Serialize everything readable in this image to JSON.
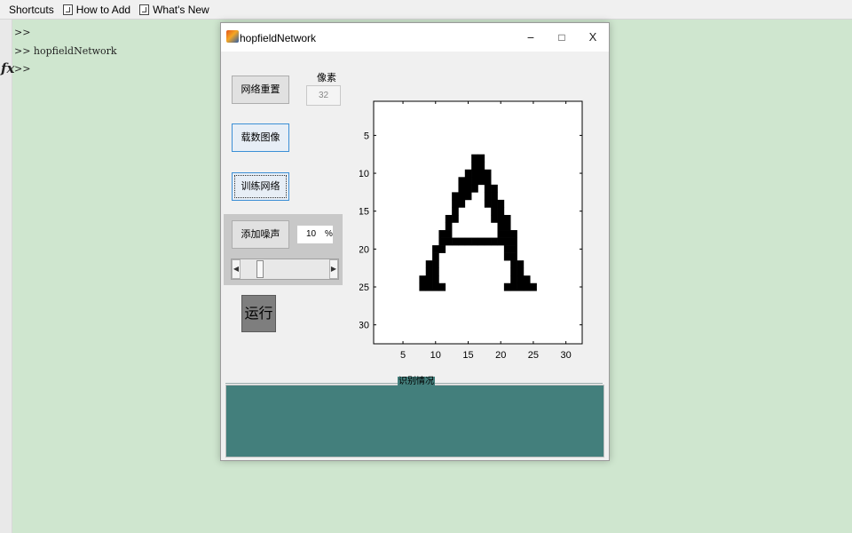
{
  "toolbar": {
    "shortcuts": "Shortcuts",
    "how_to_add": "How to Add",
    "whats_new": "What's New"
  },
  "command_window": {
    "lines": [
      ">>",
      ">> hopfieldNetwork",
      ">>"
    ],
    "fx": "fx"
  },
  "figure": {
    "title": "hopfieldNetwork",
    "controls": {
      "minimize": "−",
      "maximize": "□",
      "close": "X"
    },
    "reset_button": "网络重置",
    "pixel_label": "像素",
    "pixel_value": "32",
    "load_button": "载数图像",
    "train_button": "训练网络",
    "noise_button": "添加噪声",
    "noise_value": "10",
    "noise_unit": "%",
    "slider_level": 0.2,
    "run_button": "运行",
    "status_title": "识别情况"
  },
  "chart_data": {
    "type": "heatmap",
    "title": "",
    "xlabel": "",
    "ylabel": "",
    "xlim": [
      0.5,
      32.5
    ],
    "ylim": [
      0.5,
      32.5
    ],
    "y_reversed": true,
    "xticks": [
      5,
      10,
      15,
      20,
      25,
      30
    ],
    "yticks": [
      5,
      10,
      15,
      20,
      25,
      30
    ],
    "colors": {
      "on": "#000000",
      "off": "#ffffff"
    },
    "black_pixels_by_row": {
      "8": [
        16,
        17
      ],
      "9": [
        16,
        17
      ],
      "10": [
        15,
        16,
        17,
        18
      ],
      "11": [
        14,
        15,
        16,
        17,
        18
      ],
      "12": [
        14,
        15,
        16,
        18,
        19
      ],
      "13": [
        13,
        14,
        15,
        18,
        19
      ],
      "14": [
        13,
        14,
        18,
        19,
        20
      ],
      "15": [
        13,
        19,
        20
      ],
      "16": [
        12,
        13,
        19,
        20,
        21
      ],
      "17": [
        12,
        20,
        21
      ],
      "18": [
        11,
        12,
        20,
        21,
        22
      ],
      "19": [
        11,
        12,
        13,
        14,
        15,
        16,
        17,
        18,
        19,
        20,
        21,
        22
      ],
      "20": [
        10,
        11,
        21,
        22
      ],
      "21": [
        10,
        21,
        22
      ],
      "22": [
        9,
        10,
        22,
        23
      ],
      "23": [
        9,
        10,
        22,
        23
      ],
      "24": [
        8,
        9,
        10,
        22,
        23,
        24
      ],
      "25": [
        8,
        9,
        10,
        11,
        21,
        22,
        23,
        24,
        25
      ]
    }
  }
}
